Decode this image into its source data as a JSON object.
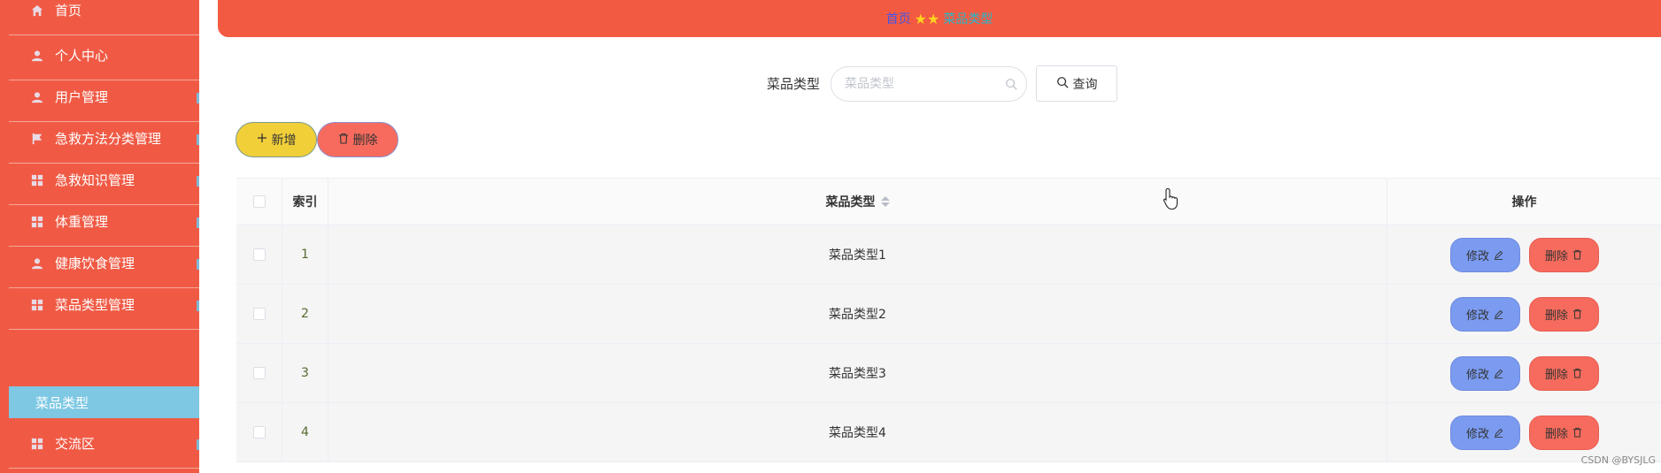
{
  "sidebar": {
    "items": [
      {
        "label": "首页",
        "icon": "home-icon"
      },
      {
        "label": "个人中心",
        "icon": "user-icon"
      },
      {
        "label": "用户管理",
        "icon": "user-icon"
      },
      {
        "label": "急救方法分类管理",
        "icon": "flag-icon"
      },
      {
        "label": "急救知识管理",
        "icon": "grid-icon"
      },
      {
        "label": "体重管理",
        "icon": "grid-icon"
      },
      {
        "label": "健康饮食管理",
        "icon": "user-icon"
      },
      {
        "label": "菜品类型管理",
        "icon": "grid-icon"
      },
      {
        "label": "交流区",
        "icon": "grid-icon"
      }
    ],
    "sub_item": "菜品类型"
  },
  "breadcrumb": {
    "home": "首页",
    "separator": "★★",
    "current": "菜品类型"
  },
  "search": {
    "label": "菜品类型",
    "placeholder": "菜品类型",
    "button": "查询"
  },
  "actions": {
    "add": "新增",
    "delete": "删除"
  },
  "table": {
    "headers": {
      "index": "索引",
      "name": "菜品类型",
      "ops": "操作"
    },
    "rows": [
      {
        "index": "1",
        "name": "菜品类型1"
      },
      {
        "index": "2",
        "name": "菜品类型2"
      },
      {
        "index": "3",
        "name": "菜品类型3"
      },
      {
        "index": "4",
        "name": "菜品类型4"
      }
    ],
    "edit_label": "修改",
    "delete_label": "删除"
  },
  "watermark": "CSDN @BYSJLG",
  "colors": {
    "sidebar_bg": "#f05a45",
    "header_bg": "#f35a42",
    "active_sub_bg": "#7ec8e3",
    "add_btn": "#f1cf39",
    "delete_btn": "#f66b5d",
    "edit_btn": "#7b9bf0"
  }
}
